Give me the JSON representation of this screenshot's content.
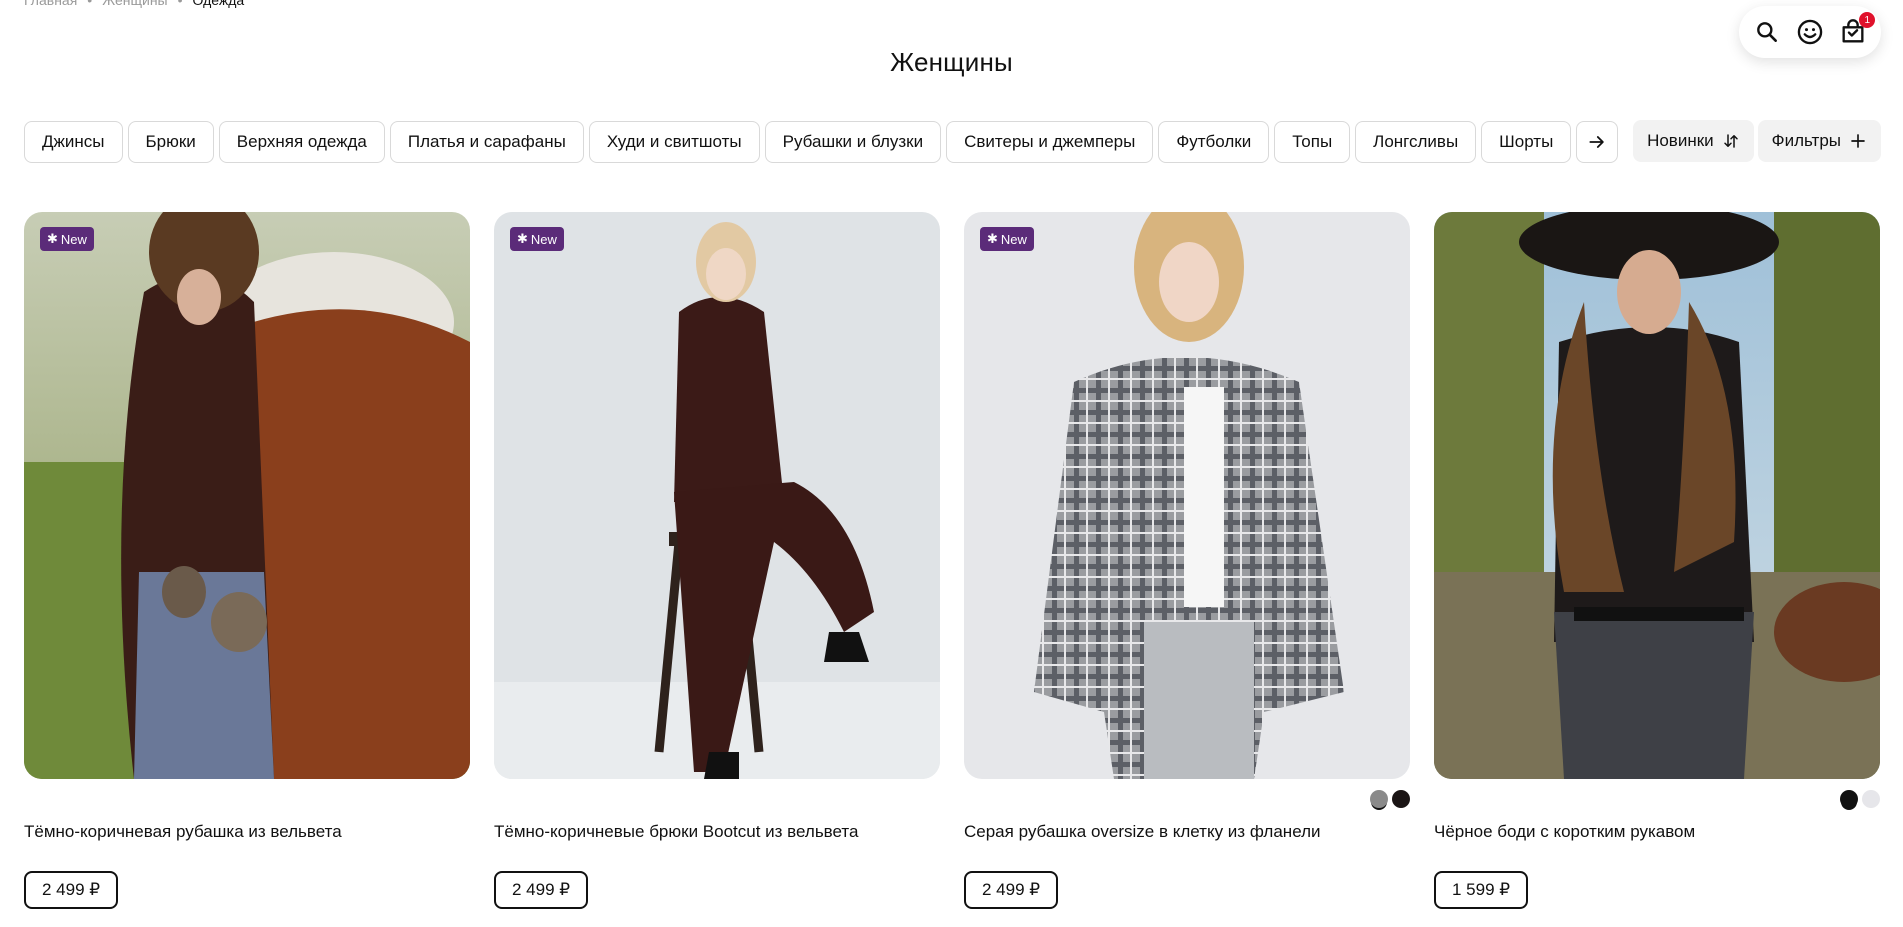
{
  "breadcrumb": {
    "items": [
      "Главная",
      "Женщины",
      "Одежда"
    ],
    "separator": "•"
  },
  "page": {
    "title": "Женщины"
  },
  "header_actions": {
    "search_icon": "search-icon",
    "profile_icon": "smiley-icon",
    "cart_icon": "bag-icon",
    "cart_count": "1"
  },
  "categories": {
    "items": [
      "Джинсы",
      "Брюки",
      "Верхняя одежда",
      "Платья и сарафаны",
      "Худи и свитшоты",
      "Рубашки и блузки",
      "Свитеры и джемперы",
      "Футболки",
      "Топы",
      "Лонгсливы",
      "Шорты"
    ],
    "next_icon": "arrow-right-icon"
  },
  "sort": {
    "label": "Новинки"
  },
  "filters": {
    "label": "Фильтры"
  },
  "badge_label": "New",
  "products": [
    {
      "name": "Тёмно-коричневая рубашка из вельвета",
      "price": "2 499 ₽",
      "is_new": true
    },
    {
      "name": "Тёмно-коричневые брюки Bootcut из вельвета",
      "price": "2 499 ₽",
      "is_new": true
    },
    {
      "name": "Серая рубашка oversize в клетку из фланели",
      "price": "2 499 ₽",
      "is_new": true,
      "colors": [
        "#8a8a8a",
        "#1a1414"
      ]
    },
    {
      "name": "Чёрное боди с коротким рукавом",
      "price": "1 599 ₽",
      "is_new": false,
      "colors": [
        "#111111",
        "#e6e6ea"
      ]
    }
  ],
  "colors": {
    "badge": "#5b2b79",
    "cart_badge": "#e0112b",
    "chip_border": "#d9d9d9"
  }
}
